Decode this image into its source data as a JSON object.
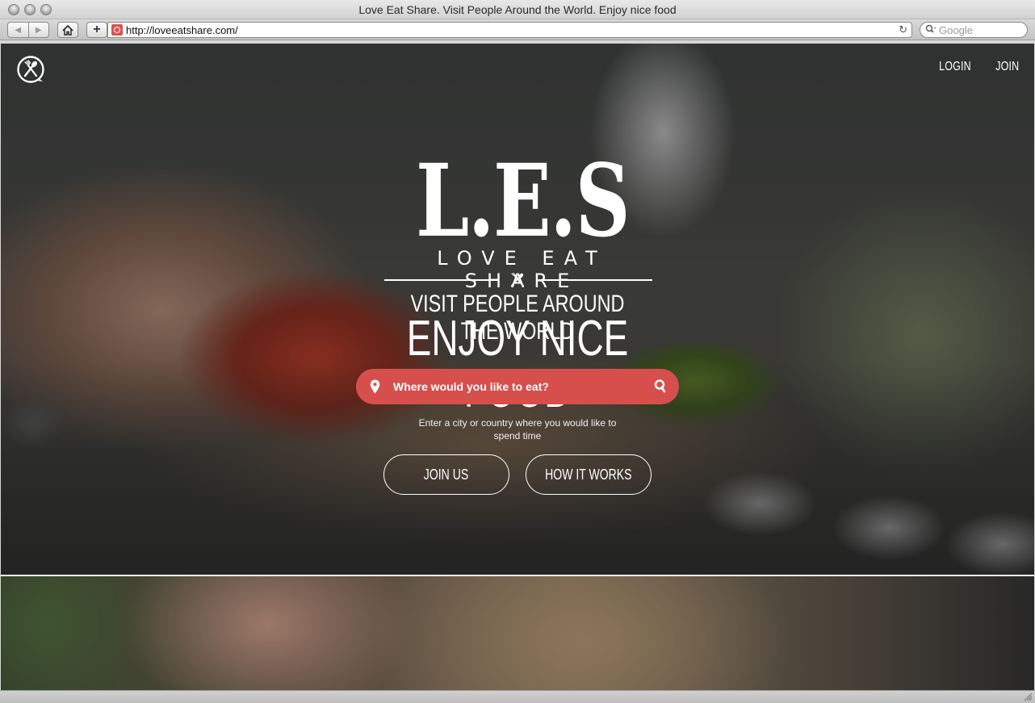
{
  "browser": {
    "window_title": "Love Eat Share. Visit People Around the World. Enjoy nice food",
    "url": "http://loveeatshare.com/",
    "search_placeholder": "Google",
    "icons": {
      "back": "back-arrow-icon",
      "forward": "forward-arrow-icon",
      "home": "home-icon",
      "add": "plus-icon",
      "reload": "reload-icon",
      "search": "search-icon"
    }
  },
  "site": {
    "nav": {
      "login": "LOGIN",
      "join": "JOIN"
    },
    "hero": {
      "logo_text": "L.E.S",
      "subtitle": "LOVE EAT SHARE",
      "tagline_line1": "VISIT PEOPLE AROUND THE WORLD",
      "tagline_line2": "ENJOY NICE FOOD",
      "search_placeholder": "Where would you like to eat?",
      "hint": "Enter a city or country where you would like to spend time",
      "cta_join": "JOIN US",
      "cta_how": "HOW IT WORKS"
    },
    "colors": {
      "accent": "#d64f4d",
      "text": "#ffffff"
    }
  }
}
